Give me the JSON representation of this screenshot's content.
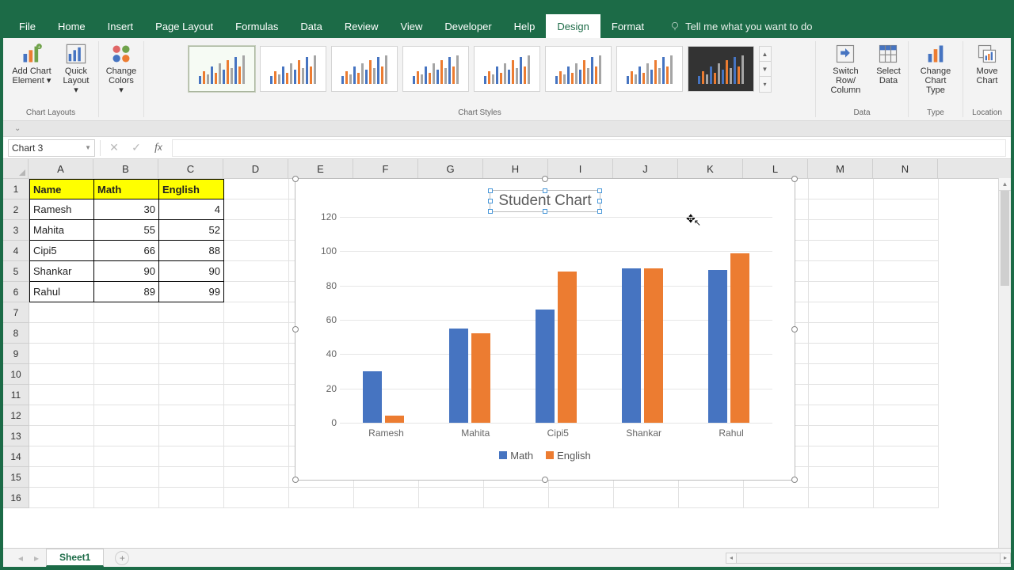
{
  "tabs": [
    "File",
    "Home",
    "Insert",
    "Page Layout",
    "Formulas",
    "Data",
    "Review",
    "View",
    "Developer",
    "Help",
    "Design",
    "Format"
  ],
  "active_tab": "Design",
  "tellme": "Tell me what you want to do",
  "ribbon": {
    "groups": {
      "layouts": {
        "label": "Chart Layouts",
        "btns": [
          "Add Chart Element ▾",
          "Quick Layout ▾"
        ]
      },
      "colors": {
        "label": "",
        "btn": "Change Colors ▾"
      },
      "styles": {
        "label": "Chart Styles"
      },
      "data": {
        "label": "Data",
        "btns": [
          "Switch Row/ Column",
          "Select Data"
        ]
      },
      "type": {
        "label": "Type",
        "btn": "Change Chart Type"
      },
      "location": {
        "label": "Location",
        "btn": "Move Chart"
      }
    }
  },
  "name_box": "Chart 3",
  "columns": [
    "A",
    "B",
    "C",
    "D",
    "E",
    "F",
    "G",
    "H",
    "I",
    "J",
    "K",
    "L",
    "M",
    "N"
  ],
  "rows": 16,
  "table": {
    "headers": [
      "Name",
      "Math",
      "English"
    ],
    "rows": [
      [
        "Ramesh",
        "30",
        "4"
      ],
      [
        "Mahita",
        "55",
        "52"
      ],
      [
        "Cipi5",
        "66",
        "88"
      ],
      [
        "Shankar",
        "90",
        "90"
      ],
      [
        "Rahul",
        "89",
        "99"
      ]
    ]
  },
  "chart_data": {
    "type": "bar",
    "title": "Student Chart",
    "categories": [
      "Ramesh",
      "Mahita",
      "Cipi5",
      "Shankar",
      "Rahul"
    ],
    "series": [
      {
        "name": "Math",
        "values": [
          30,
          55,
          66,
          90,
          89
        ],
        "color": "#4674c1"
      },
      {
        "name": "English",
        "values": [
          4,
          52,
          88,
          90,
          99
        ],
        "color": "#ec7c31"
      }
    ],
    "ylim": [
      0,
      120
    ],
    "yticks": [
      0,
      20,
      40,
      60,
      80,
      100,
      120
    ],
    "xlabel": "",
    "ylabel": "",
    "legend_position": "bottom"
  },
  "sheet_tab": "Sheet1"
}
